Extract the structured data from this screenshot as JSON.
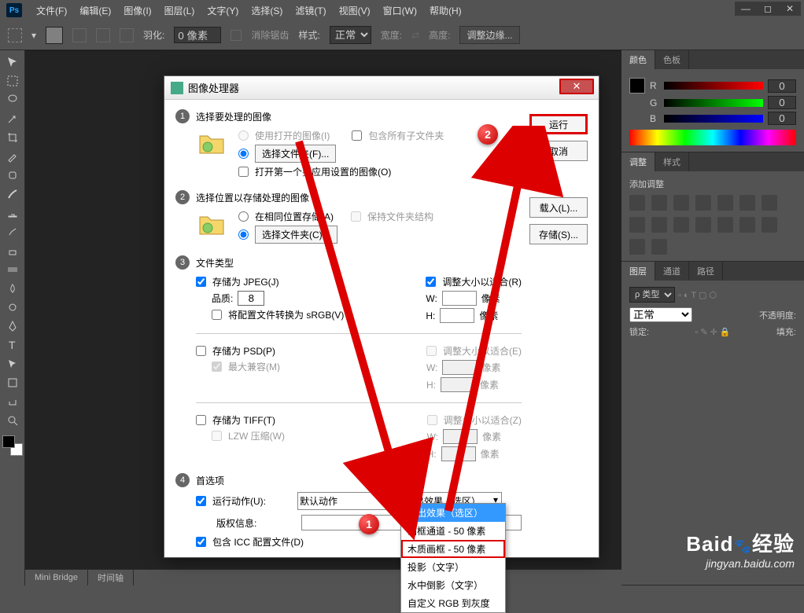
{
  "menubar": {
    "logo": "Ps",
    "items": [
      "文件(F)",
      "编辑(E)",
      "图像(I)",
      "图层(L)",
      "文字(Y)",
      "选择(S)",
      "滤镜(T)",
      "视图(V)",
      "窗口(W)",
      "帮助(H)"
    ]
  },
  "optionsbar": {
    "feather_label": "羽化:",
    "feather_value": "0 像素",
    "antialias": "消除锯齿",
    "style_label": "样式:",
    "style_value": "正常",
    "width_label": "宽度:",
    "height_label": "高度:",
    "refine": "调整边缘..."
  },
  "right_panels": {
    "color_tab": "颜色",
    "swatch_tab": "色板",
    "r_label": "R",
    "g_label": "G",
    "b_label": "B",
    "r_val": "0",
    "g_val": "0",
    "b_val": "0",
    "adjust_tab": "调整",
    "style_tab": "样式",
    "adjust_title": "添加调整",
    "layers_tab": "图层",
    "channels_tab": "通道",
    "paths_tab": "路径",
    "kind_label": "ρ 类型",
    "blend": "正常",
    "opacity_label": "不透明度:",
    "lock_label": "锁定:",
    "fill_label": "填充:"
  },
  "bottombar": {
    "minibridge": "Mini Bridge",
    "timeline": "时间轴"
  },
  "dialog": {
    "title": "图像处理器",
    "run_btn": "运行",
    "cancel_btn": "取消",
    "load_btn": "载入(L)...",
    "save_btn": "存储(S)...",
    "section1": {
      "num": "1",
      "title": "选择要处理的图像",
      "use_open": "使用打开的图像(I)",
      "include_sub": "包含所有子文件夹",
      "select_folder": "选择文件夹(F)...",
      "open_first": "打开第一个要应用设置的图像(O)"
    },
    "section2": {
      "num": "2",
      "title": "选择位置以存储处理的图像",
      "same_loc": "在相同位置存储(A)",
      "keep_struct": "保持文件夹结构",
      "select_folder": "选择文件夹(C)..."
    },
    "section3": {
      "num": "3",
      "title": "文件类型",
      "save_jpeg": "存储为 JPEG(J)",
      "quality_label": "品质:",
      "quality_val": "8",
      "resize_fit": "调整大小以适合(R)",
      "w_label": "W:",
      "h_label": "H:",
      "px": "像素",
      "convert_srgb": "将配置文件转换为 sRGB(V)",
      "save_psd": "存储为 PSD(P)",
      "resize_fit_e": "调整大小以适合(E)",
      "max_compat": "最大兼容(M)",
      "save_tiff": "存储为 TIFF(T)",
      "resize_fit_z": "调整大小以适合(Z)",
      "lzw": "LZW 压缩(W)"
    },
    "section4": {
      "num": "4",
      "title": "首选项",
      "run_action": "运行动作(U):",
      "action_set": "默认动作",
      "action_selected": "淡出效果（选区）",
      "copyright": "版权信息:",
      "include_icc": "包含 ICC 配置文件(D)"
    }
  },
  "dropdown": {
    "items": [
      "淡出效果（选区）",
      "画框通道 - 50 像素",
      "木质画框 - 50 像素",
      "投影（文字）",
      "水中倒影（文字）",
      "自定义 RGB 到灰度"
    ]
  },
  "annotations": {
    "badge1": "1",
    "badge2": "2"
  },
  "watermark": {
    "brand": "Baid",
    "brand2": "经验",
    "sub": "jingyan.baidu.com"
  }
}
